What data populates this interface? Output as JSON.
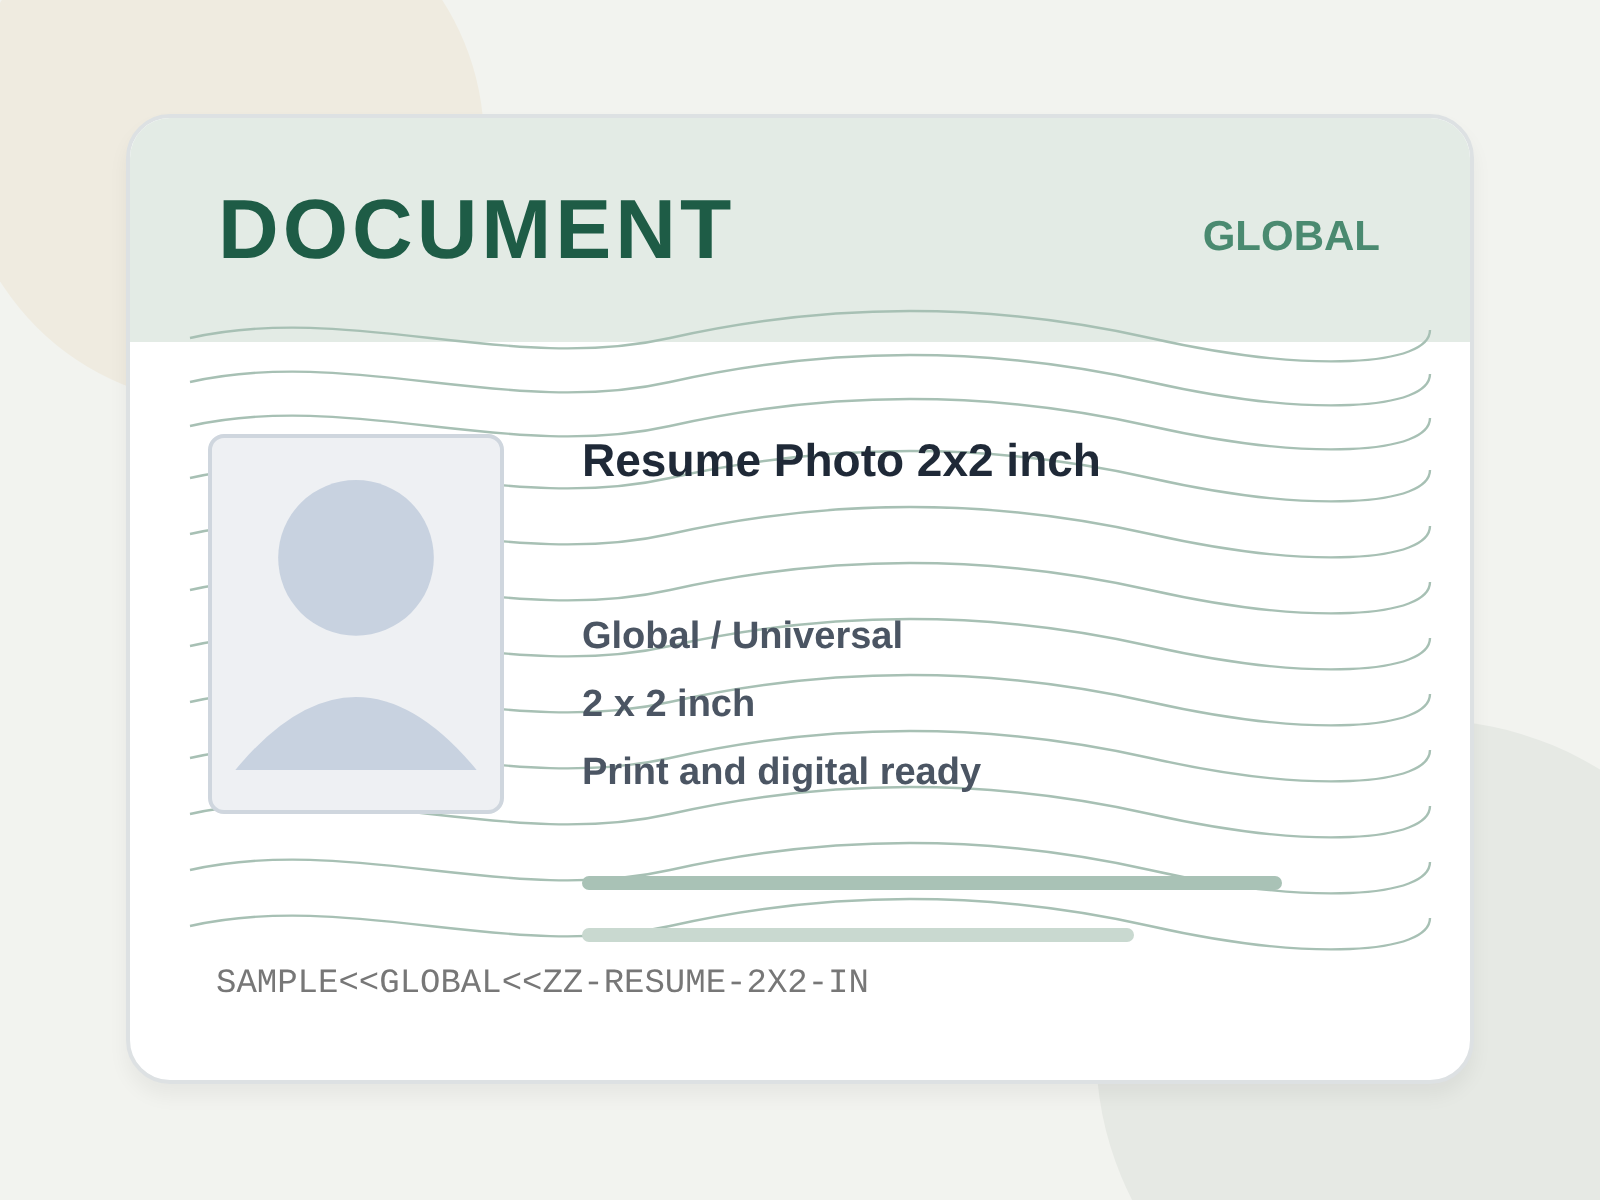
{
  "card": {
    "header": {
      "title": "DOCUMENT",
      "region": "GLOBAL"
    },
    "title": "Resume Photo 2x2 inch",
    "details": [
      "Global / Universal",
      "2 x 2 inch",
      "Print and digital ready"
    ],
    "mrz": "SAMPLE<<GLOBAL<<ZZ-RESUME-2X2-IN"
  }
}
